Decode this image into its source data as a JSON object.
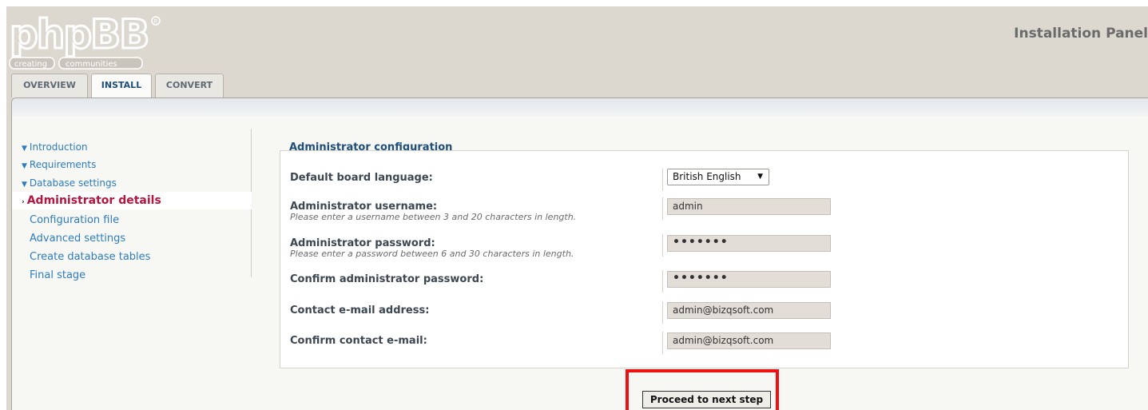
{
  "header": {
    "logo_text": "phpBB",
    "logo_tagline_1": "creating",
    "logo_tagline_2": "communities",
    "panel_title": "Installation Panel"
  },
  "tabs": [
    {
      "label": "OVERVIEW",
      "active": false
    },
    {
      "label": "INSTALL",
      "active": true
    },
    {
      "label": "CONVERT",
      "active": false
    }
  ],
  "sidebar": {
    "items": [
      {
        "label": "Introduction",
        "state": "done"
      },
      {
        "label": "Requirements",
        "state": "done"
      },
      {
        "label": "Database settings",
        "state": "done"
      },
      {
        "label": "Administrator details",
        "state": "active"
      },
      {
        "label": "Configuration file",
        "state": "todo"
      },
      {
        "label": "Advanced settings",
        "state": "todo"
      },
      {
        "label": "Create database tables",
        "state": "todo"
      },
      {
        "label": "Final stage",
        "state": "todo"
      }
    ]
  },
  "content": {
    "title": "Administrator configuration",
    "fields": {
      "language": {
        "label": "Default board language:",
        "value": "British English"
      },
      "username": {
        "label": "Administrator username:",
        "explain": "Please enter a username between 3 and 20 characters in length.",
        "value": "admin"
      },
      "password": {
        "label": "Administrator password:",
        "explain": "Please enter a password between 6 and 30 characters in length.",
        "value": "•••••••"
      },
      "password_confirm": {
        "label": "Confirm administrator password:",
        "value": "•••••••"
      },
      "email": {
        "label": "Contact e-mail address:",
        "value": "admin@bizqsoft.com"
      },
      "email_confirm": {
        "label": "Confirm contact e-mail:",
        "value": "admin@bizqsoft.com"
      }
    },
    "proceed_label": "Proceed to next step"
  },
  "colors": {
    "header_bg": "#dcd8d0",
    "link_blue": "#2e7cbf",
    "active_red": "#b7143e",
    "title_blue": "#1f4e79",
    "highlight_box": "#ee1111"
  }
}
